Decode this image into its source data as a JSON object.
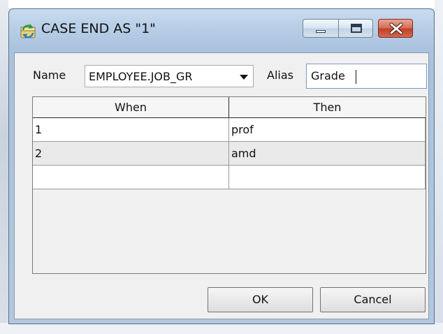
{
  "window": {
    "title": "CASE END AS \"1\"",
    "icon": "refresh-db-icon",
    "caption_buttons": [
      "minimize-icon",
      "maximize-icon",
      "close-icon"
    ]
  },
  "form": {
    "name_label": "Name",
    "name_value": "EMPLOYEE.JOB_GR",
    "alias_label": "Alias",
    "alias_value": "Grade"
  },
  "grid": {
    "columns": [
      "When",
      "Then"
    ],
    "rows": [
      {
        "when": "1",
        "then": "prof"
      },
      {
        "when": "2",
        "then": "amd"
      },
      {
        "when": "",
        "then": ""
      }
    ]
  },
  "buttons": {
    "ok": "OK",
    "cancel": "Cancel"
  },
  "colors": {
    "title_bar": "#b6cde6",
    "close_button": "#c1402a",
    "client_bg": "#f0f0f0"
  }
}
